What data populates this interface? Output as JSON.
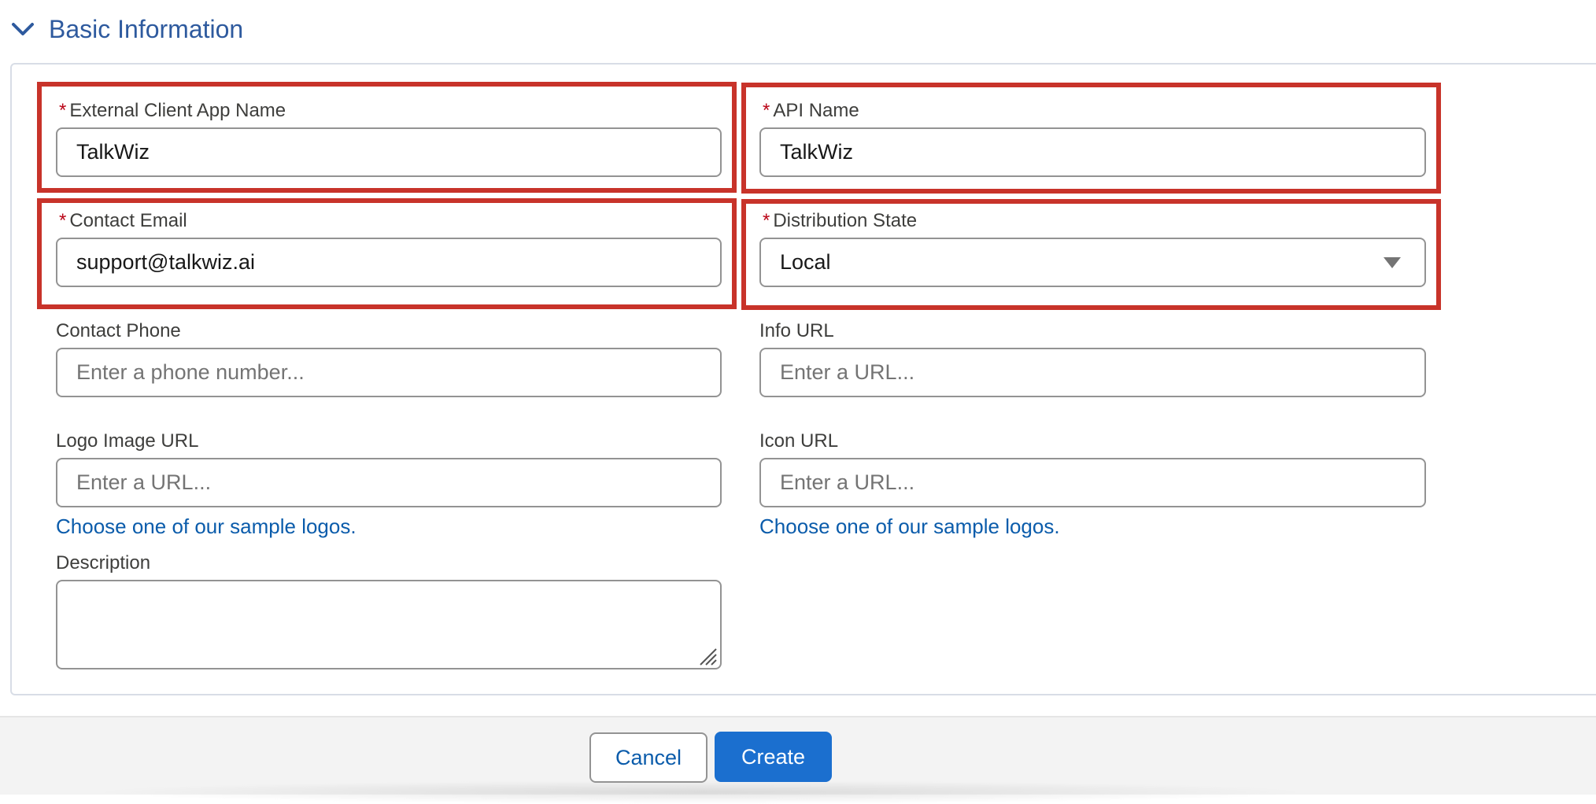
{
  "section": {
    "title": "Basic Information"
  },
  "fields": {
    "app_name": {
      "label": "External Client App Name",
      "required_mark": "*",
      "value": "TalkWiz"
    },
    "api_name": {
      "label": "API Name",
      "required_mark": "*",
      "value": "TalkWiz"
    },
    "contact_email": {
      "label": "Contact Email",
      "required_mark": "*",
      "value": "support@talkwiz.ai"
    },
    "distribution_state": {
      "label": "Distribution State",
      "required_mark": "*",
      "value": "Local"
    },
    "contact_phone": {
      "label": "Contact Phone",
      "placeholder": "Enter a phone number..."
    },
    "info_url": {
      "label": "Info URL",
      "placeholder": "Enter a URL..."
    },
    "logo_image_url": {
      "label": "Logo Image URL",
      "placeholder": "Enter a URL...",
      "link": "Choose one of our sample logos."
    },
    "icon_url": {
      "label": "Icon URL",
      "placeholder": "Enter a URL...",
      "link": "Choose one of our sample logos."
    },
    "description": {
      "label": "Description",
      "value": ""
    }
  },
  "footer": {
    "cancel_label": "Cancel",
    "create_label": "Create"
  },
  "colors": {
    "accent": "#1b6fcf",
    "link": "#0b5cab",
    "section_title": "#2e5a9e",
    "highlight": "#c8332a",
    "required": "#ba0517"
  }
}
